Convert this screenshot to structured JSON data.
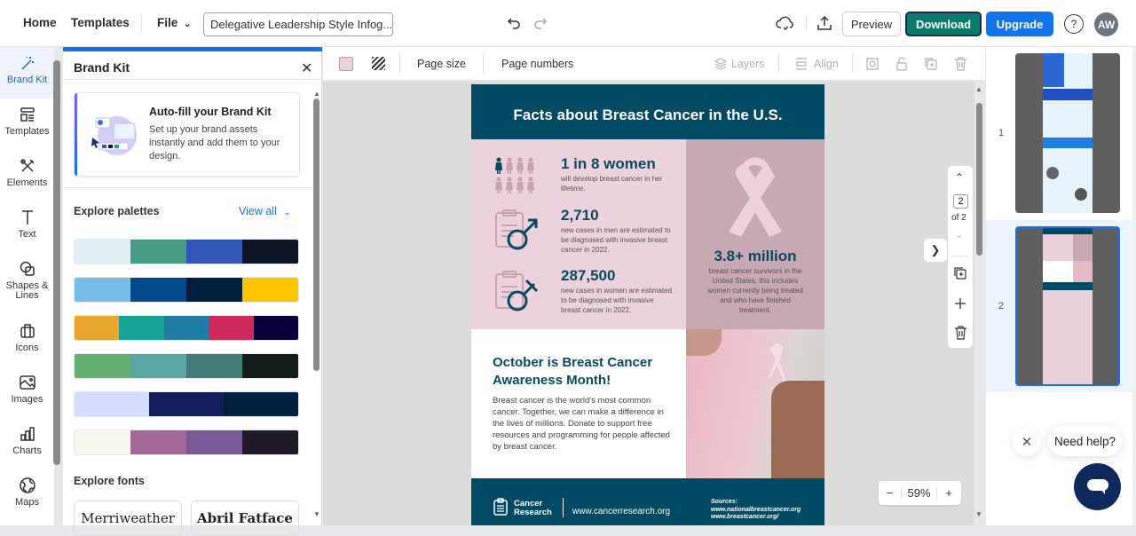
{
  "topbar": {
    "home": "Home",
    "templates": "Templates",
    "file": "File",
    "doc_title": "Delegative Leadership Style Infog...",
    "preview": "Preview",
    "download": "Download",
    "upgrade": "Upgrade",
    "help": "?",
    "avatar_initials": "AW"
  },
  "rail": {
    "items": [
      {
        "label": "Brand Kit",
        "icon": "magic-wand-icon"
      },
      {
        "label": "Templates",
        "icon": "templates-icon"
      },
      {
        "label": "Elements",
        "icon": "elements-icon"
      },
      {
        "label": "Text",
        "icon": "text-icon"
      },
      {
        "label": "Shapes &\nLines",
        "icon": "shapes-icon"
      },
      {
        "label": "Icons",
        "icon": "icons-icon"
      },
      {
        "label": "Images",
        "icon": "image-icon"
      },
      {
        "label": "Charts",
        "icon": "chart-icon"
      },
      {
        "label": "Maps",
        "icon": "globe-icon"
      }
    ]
  },
  "panel": {
    "title": "Brand Kit",
    "autofill_title": "Auto-fill your Brand Kit",
    "autofill_desc": "Set up your brand assets instantly and add them to your design.",
    "palettes_label": "Explore palettes",
    "view_all": "View all",
    "palettes": [
      [
        "#e3eef5",
        "#469b84",
        "#3456b8",
        "#0d1526"
      ],
      [
        "#78bde8",
        "#034a8c",
        "#001e3d",
        "#ffc400"
      ],
      [
        "#e9a62e",
        "#17a294",
        "#227da6",
        "#cf2a5b",
        "#08003c"
      ],
      [
        "#63b073",
        "#59a7a2",
        "#417c78",
        "#141c1c"
      ],
      [
        "#d5dcfd",
        "#131d5c",
        "#001f3f"
      ],
      [
        "#f8f8f1",
        "#a3679a",
        "#795a96",
        "#221a29"
      ]
    ],
    "fonts_label": "Explore fonts",
    "fonts": [
      "Merriweather",
      "Abril Fatface"
    ]
  },
  "toolbar": {
    "page_size": "Page size",
    "page_numbers": "Page numbers",
    "layers": "Layers",
    "align": "Align",
    "bg_color": "#ead3dc"
  },
  "page": {
    "heading": "Facts about Breast Cancer in the U.S.",
    "stats": [
      {
        "value": "1 in 8 women",
        "text": "will develop breast cancer in her lifetime."
      },
      {
        "value": "2,710",
        "text": "new cases in men are estimated to be diagnosed with invasive breast cancer in 2022."
      },
      {
        "value": "287,500",
        "text": "new cases in women are estimated to be diagnosed with invasive breast cancer in 2022."
      }
    ],
    "survivors_value": "3.8+ million",
    "survivors_text": "breast cancer survivors in the United States, this includes women currently being treated and who have finished treatment.",
    "october_title": "October is Breast Cancer Awareness Month!",
    "october_body": "Breast cancer is the world's most common cancer. Together, we can make a difference in the lives of millions. Donate to support free resources and programming for people affected by breast cancer.",
    "footer_org": "Cancer Research",
    "footer_url": "www.cancerresearch.org",
    "sources_label": "Sources:",
    "sources": [
      "www.nationalbreastcancer.org",
      "www.breastcancer.org/"
    ]
  },
  "pager": {
    "current": "2",
    "total_label": "of 2"
  },
  "zoom": {
    "value": "59",
    "unit": "%",
    "minus": "−",
    "plus": "+"
  },
  "thumbs": [
    {
      "number": "1"
    },
    {
      "number": "2"
    }
  ],
  "help": {
    "bubble": "Need help?"
  }
}
